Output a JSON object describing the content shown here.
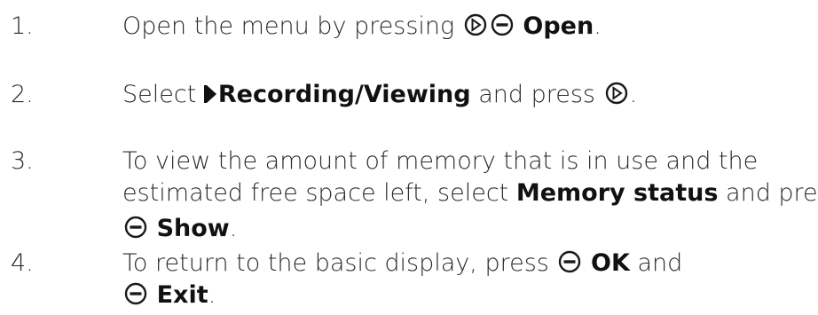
{
  "steps": [
    {
      "number": "1.",
      "before": "Open the menu by pressing",
      "bold": "Open",
      "after": "."
    },
    {
      "number": "2.",
      "before": "Select",
      "bold": "Recording/Viewing",
      "middle": "and press",
      "after": "."
    },
    {
      "number": "3.",
      "line1": "To view the amount of memory that is in use and the",
      "line2_before": "estimated free space left, select",
      "line2_bold": "Memory status",
      "line2_after": "and press",
      "line3_bold": "Show",
      "line3_after": "."
    },
    {
      "number": "4.",
      "before": "To return to the basic display, press",
      "bold1": "OK",
      "middle": "and",
      "bold2": "Exit",
      "after": "."
    }
  ],
  "icons": {
    "select_key": "navigation-select-icon",
    "soft_key": "soft-key-minus-icon",
    "menu_arrow": "menu-play-arrow-icon"
  },
  "colors": {
    "text": "#2a2a2a",
    "bold_text": "#111111",
    "icon": "#1a1a1a"
  }
}
